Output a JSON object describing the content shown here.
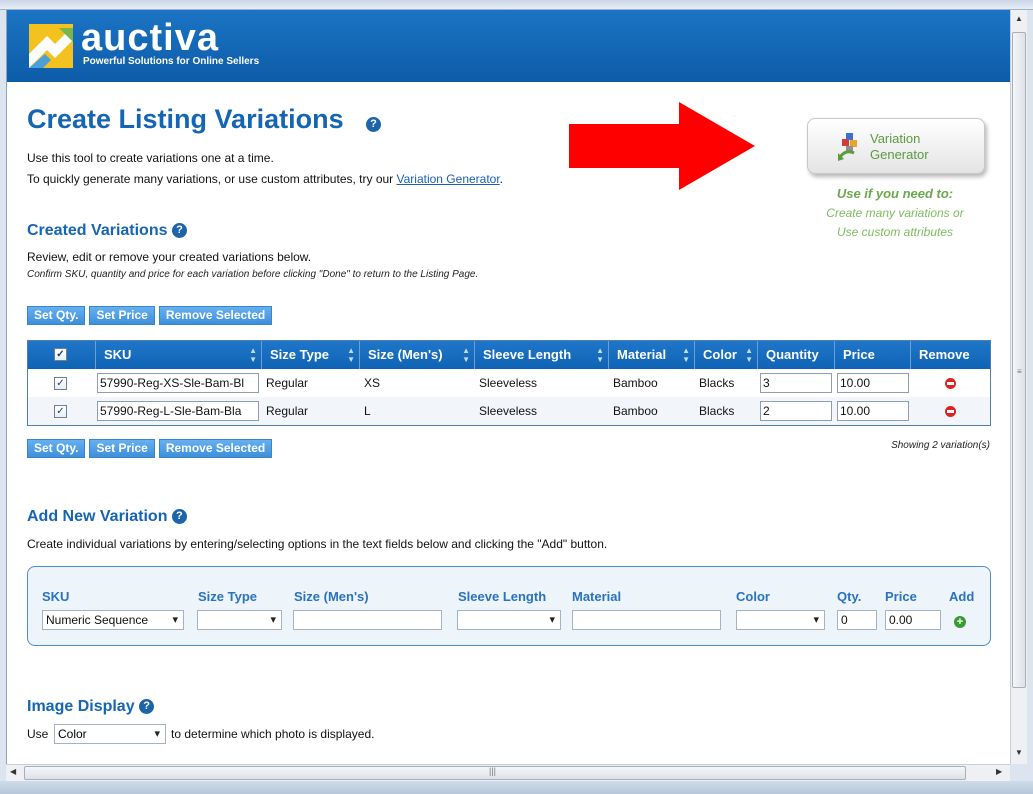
{
  "header": {
    "logo_text": "auctiva",
    "tagline": "Powerful Solutions for Online Sellers"
  },
  "page": {
    "title": "Create Listing Variations",
    "intro_line1": "Use this tool to create variations one at a time.",
    "intro_line2_prefix": "To quickly generate many variations, or use custom attributes, try our ",
    "intro_link": "Variation Generator",
    "intro_line2_suffix": "."
  },
  "generator": {
    "button_line1": "Variation",
    "button_line2": "Generator",
    "note_title": "Use if you need to:",
    "note_line1": "Create many variations or",
    "note_line2": "Use custom attributes"
  },
  "created": {
    "title": "Created Variations",
    "desc": "Review, edit or remove your created variations below.",
    "note": "Confirm SKU, quantity and price for each variation before clicking \"Done\" to return to the Listing Page.",
    "buttons": {
      "set_qty": "Set Qty.",
      "set_price": "Set Price",
      "remove_selected": "Remove Selected"
    },
    "columns": {
      "check": "✓",
      "sku": "SKU",
      "size_type": "Size Type",
      "size": "Size (Men's)",
      "sleeve": "Sleeve Length",
      "material": "Material",
      "color": "Color",
      "quantity": "Quantity",
      "price": "Price",
      "remove": "Remove"
    },
    "rows": [
      {
        "checked": "✓",
        "sku": "57990-Reg-XS-Sle-Bam-Bl",
        "size_type": "Regular",
        "size": "XS",
        "sleeve": "Sleeveless",
        "material": "Bamboo",
        "color": "Blacks",
        "quantity": "3",
        "price": "10.00"
      },
      {
        "checked": "✓",
        "sku": "57990-Reg-L-Sle-Bam-Bla",
        "size_type": "Regular",
        "size": "L",
        "sleeve": "Sleeveless",
        "material": "Bamboo",
        "color": "Blacks",
        "quantity": "2",
        "price": "10.00"
      }
    ],
    "showing": "Showing 2 variation(s)"
  },
  "add_new": {
    "title": "Add New Variation",
    "desc": "Create individual variations by entering/selecting options in the text fields below and clicking the \"Add\" button.",
    "labels": {
      "sku": "SKU",
      "size_type": "Size Type",
      "size": "Size (Men's)",
      "sleeve": "Sleeve Length",
      "material": "Material",
      "color": "Color",
      "qty": "Qty.",
      "price": "Price",
      "add": "Add"
    },
    "values": {
      "sku_select": "Numeric Sequence",
      "size_type": "",
      "size": "",
      "sleeve": "",
      "material": "",
      "color": "",
      "qty": "0",
      "price": "0.00"
    }
  },
  "image_display": {
    "title": "Image Display",
    "prefix": "Use",
    "selected": "Color",
    "suffix": "to determine which photo is displayed."
  },
  "colors": {
    "brand_blue": "#1565b3",
    "header_blue": "#1b74c4",
    "green_note": "#6aa84f",
    "arrow_red": "#ff0000"
  }
}
